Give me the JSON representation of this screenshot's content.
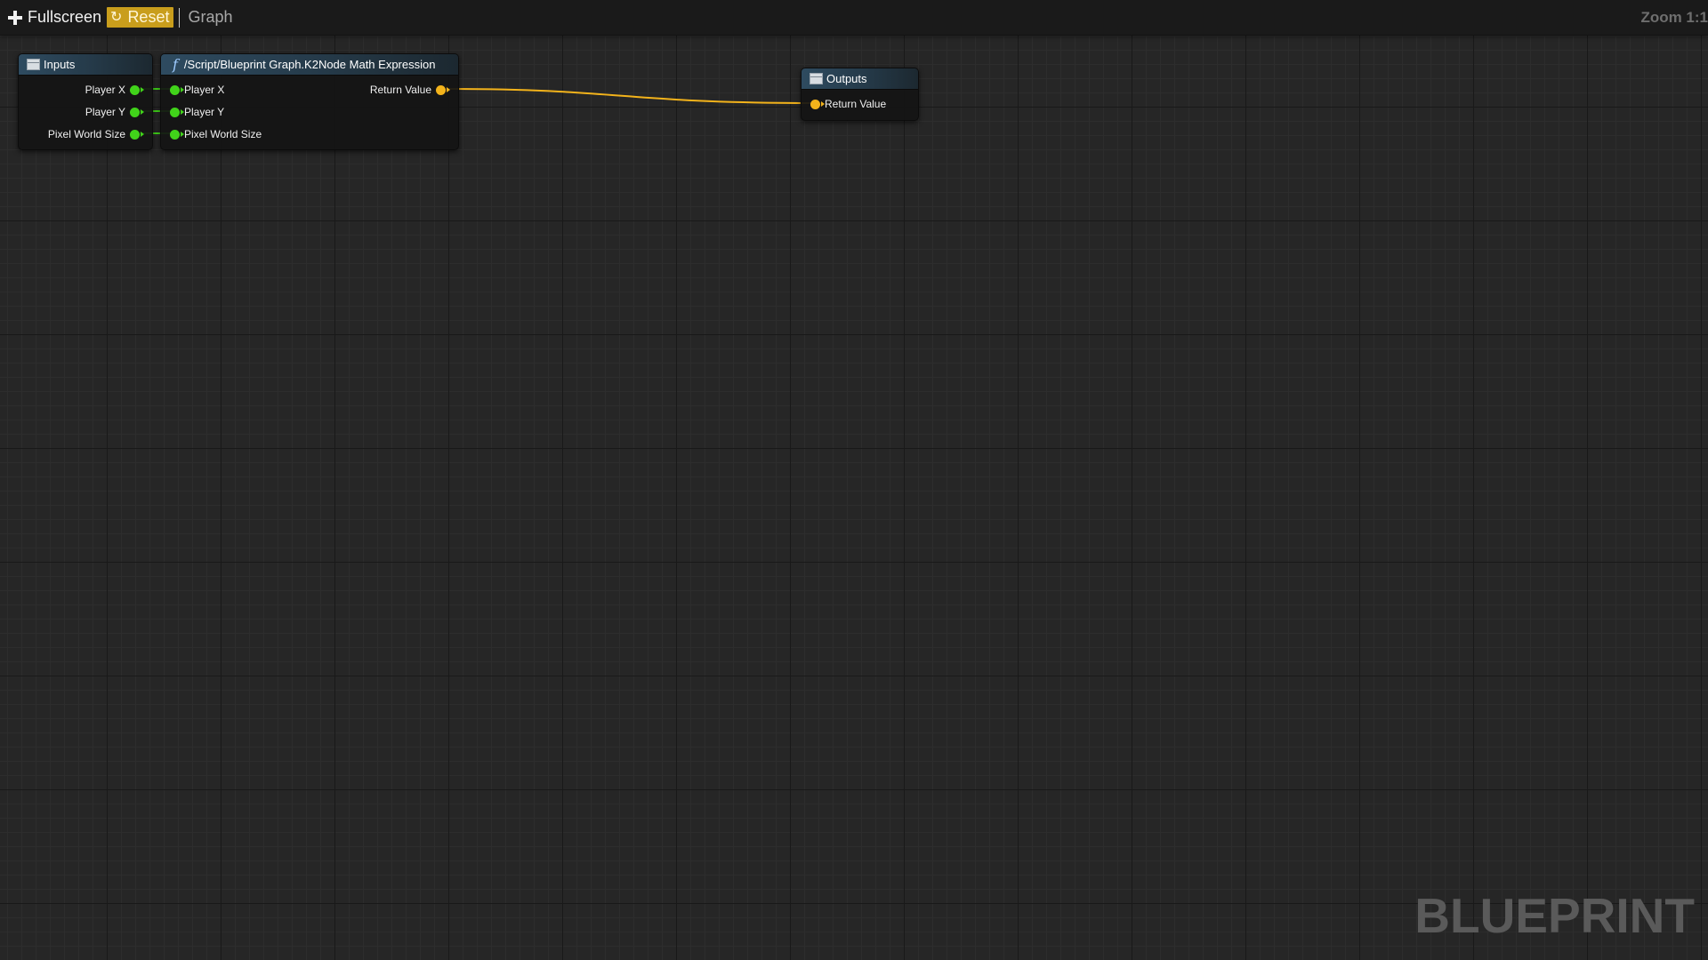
{
  "toolbar": {
    "fullscreen_label": "Fullscreen",
    "reset_label": "Reset",
    "title": "Graph",
    "zoom": "Zoom 1:1"
  },
  "watermark": "BLUEPRINT",
  "nodes": {
    "inputs": {
      "title": "Inputs",
      "pins": [
        "Player X",
        "Player Y",
        "Pixel World Size"
      ]
    },
    "math": {
      "title": "/Script/Blueprint Graph.K2Node Math Expression",
      "inputs": [
        "Player X",
        "Player Y",
        "Pixel World Size"
      ],
      "output": "Return Value"
    },
    "outputs": {
      "title": "Outputs",
      "pins": [
        "Return Value"
      ]
    }
  },
  "colors": {
    "accent": "#c99e1c",
    "pin_float": "#41d31a",
    "pin_return": "#f3b31b",
    "header": "#2e4b60",
    "background": "#262626"
  }
}
